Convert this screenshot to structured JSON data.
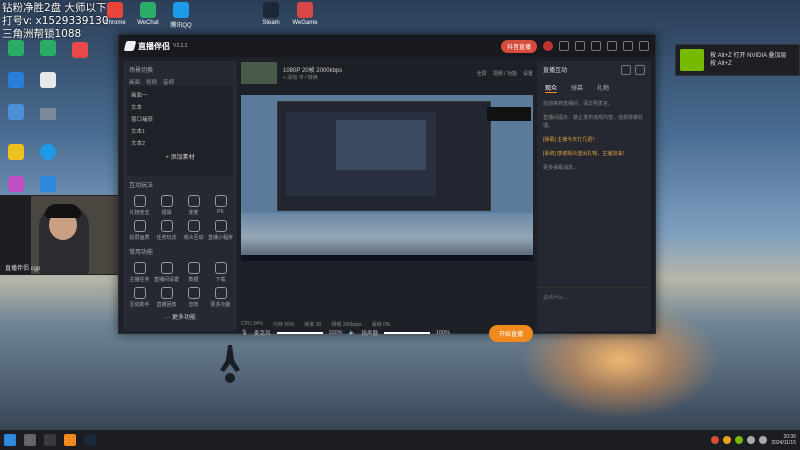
{
  "overlay": {
    "line1": "钻粉净胜2盘 大师以下",
    "line2": "打号v: x1529339130",
    "line3": "三角洲帮锁1088"
  },
  "desktop_icons": [
    {
      "label": "Chrome",
      "color": "#e8443a"
    },
    {
      "label": "WeChat",
      "color": "#2aae67"
    },
    {
      "label": "腾讯QQ",
      "color": "#1e9be8"
    },
    {
      "label": "Steam",
      "color": "#1b2838"
    },
    {
      "label": "WeGame",
      "color": "#d94646"
    }
  ],
  "webcam": {
    "caption": "直播伴侣 cgp"
  },
  "app": {
    "title": "直播伴侣",
    "version": "V3.2.2",
    "red_button": "抖音直播",
    "left": {
      "scenes_label": "场景切换",
      "source_tabs": [
        "画面",
        "视频",
        "音频"
      ],
      "sources": [
        "画面一",
        "文本",
        "窗口捕获",
        "文本1",
        "文本2"
      ],
      "add_source": "+ 添加素材",
      "interact_label": "互动玩法",
      "interact_tools": [
        "礼物连击",
        "福袋",
        "连麦",
        "PK",
        "投屏画质",
        "任务玩法",
        "观众互动",
        "直播小程序"
      ],
      "more_label": "常用功能",
      "more_tools": [
        "主播任务",
        "直播间设置",
        "数据",
        "下载",
        "互动助手",
        "直播回放",
        "音效",
        "更多功能"
      ],
      "expand": "··· 更多功能"
    },
    "cast": {
      "title": "1080P 20帧 2000kbps",
      "line2": "+ 添加 平 / 转换",
      "actions": [
        "全屏",
        "视频 / 功能",
        "设置"
      ]
    },
    "audio": {
      "mic_label": "麦克风",
      "mic_value": "100%",
      "speaker_label": "扬声器",
      "speaker_value": "100%",
      "start_button": "开始直播"
    },
    "status": [
      "CPU 34%",
      "内存 55%",
      "帧率 30",
      "网络 200kbps",
      "丢帧 0%"
    ],
    "right": {
      "header": "直播互动",
      "tabs": [
        "观众",
        "弹幕",
        "礼物"
      ],
      "messages": [
        {
          "text": "欢迎来到直播间，请文明发言。",
          "highlight": false
        },
        {
          "text": "直播间提示：禁止发布违规内容，违规将被处理。",
          "highlight": false
        },
        {
          "text": "[弹幕] 主播今天打几把？",
          "highlight": true
        },
        {
          "text": "[系统] 感谢观众送出礼物，主播加油！",
          "highlight": true
        },
        {
          "text": "更多弹幕消息...",
          "highlight": false
        }
      ],
      "input_placeholder": "说点什么..."
    }
  },
  "notification": {
    "title": "按 Alt+Z 打开 NVIDIA 叠加层",
    "subtitle": "按 Alt+Z"
  },
  "taskbar": {
    "time": "20:35",
    "date": "2024/11/15"
  },
  "colors": {
    "accent": "#f08a1c",
    "red": "#d64b3a",
    "nvidia": "#76b900"
  }
}
